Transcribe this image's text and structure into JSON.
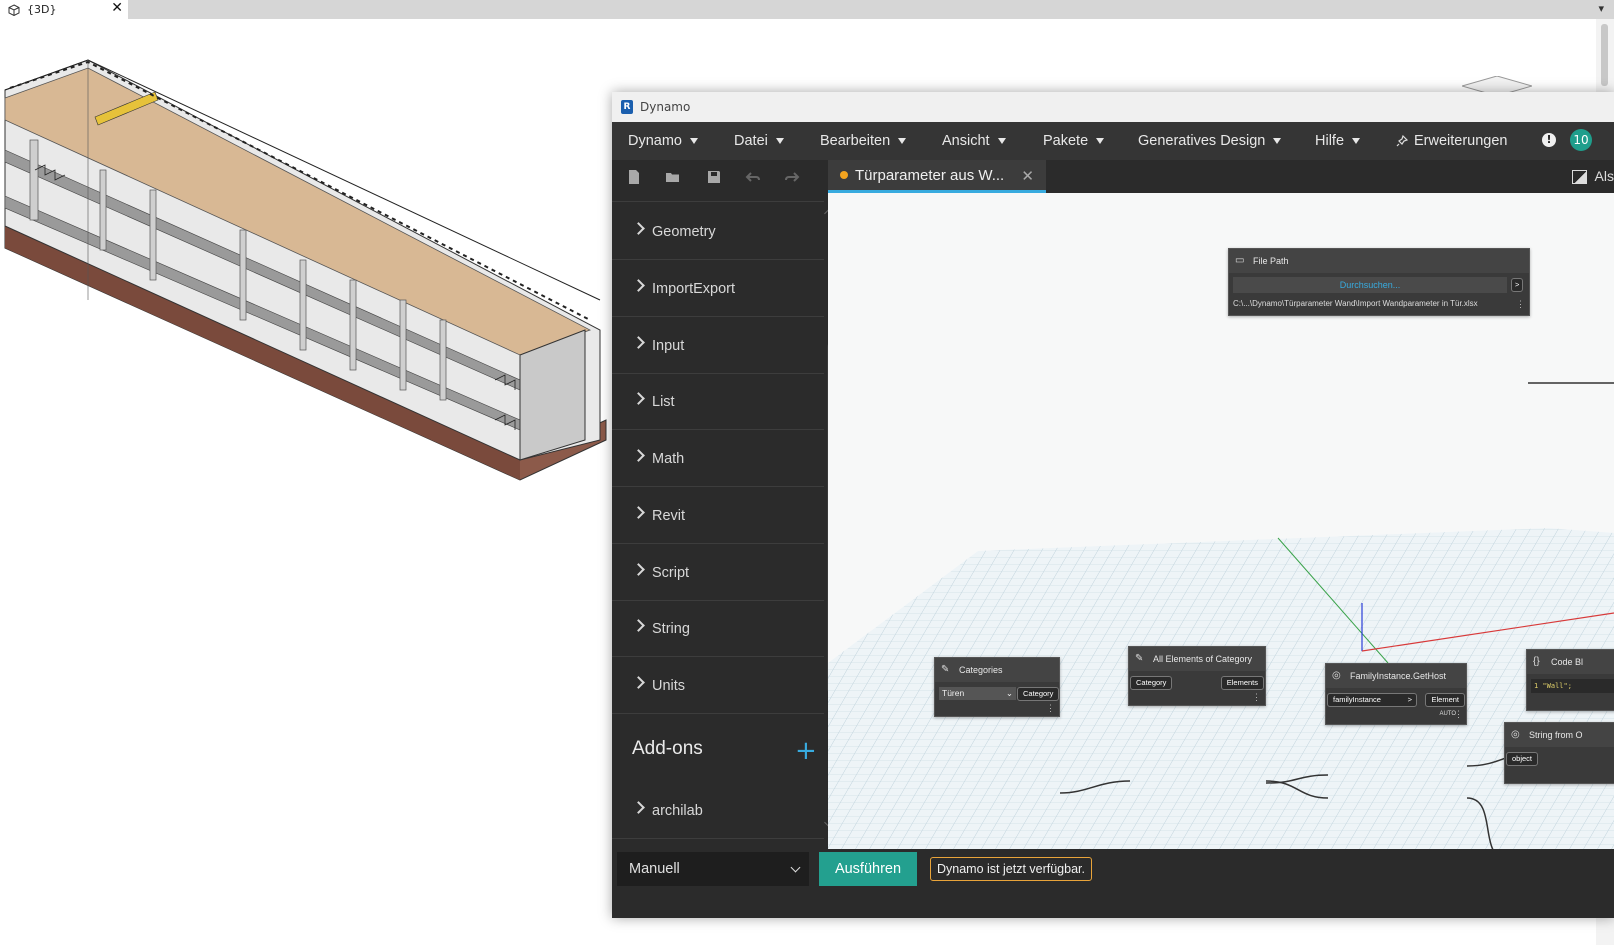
{
  "revit": {
    "tab_label": "{3D}",
    "tab_close": "✕",
    "tab_menu": "▾"
  },
  "dynamo": {
    "window_title": "Dynamo",
    "logo": "R",
    "menu": [
      {
        "label": "Dynamo"
      },
      {
        "label": "Datei"
      },
      {
        "label": "Bearbeiten"
      },
      {
        "label": "Ansicht"
      },
      {
        "label": "Pakete"
      },
      {
        "label": "Generatives Design"
      },
      {
        "label": "Hilfe"
      }
    ],
    "extensions_label": "Erweiterungen",
    "info_badge": "!",
    "notification_count": "10",
    "toolbar_icons": [
      "new-file-icon",
      "open-folder-icon",
      "save-icon",
      "undo-icon",
      "redo-icon"
    ],
    "file_tab": {
      "name": "Türparameter aus W...",
      "close": "✕"
    },
    "view_toggle_label": "Als",
    "library": {
      "items": [
        {
          "label": "Geometry"
        },
        {
          "label": "ImportExport"
        },
        {
          "label": "Input"
        },
        {
          "label": "List"
        },
        {
          "label": "Math"
        },
        {
          "label": "Revit"
        },
        {
          "label": "Script"
        },
        {
          "label": "String"
        },
        {
          "label": "Units"
        }
      ],
      "addons_title": "Add-ons",
      "addons_plus": "+",
      "addons_items": [
        {
          "label": "archilab"
        }
      ]
    },
    "nodes": {
      "file_path": {
        "title": "File Path",
        "browse": "Durchsuchen...",
        "path": "C:\\...\\Dynamo\\Türparameter Wand\\Import Wandparameter in Tür.xlsx",
        "out_port": ">"
      },
      "categories": {
        "title": "Categories",
        "value": "Türen",
        "out_port": "Category"
      },
      "all_elements": {
        "title": "All Elements of Category",
        "in_port": "Category",
        "out_port": "Elements"
      },
      "get_host": {
        "title": "FamilyInstance.GetHost",
        "in_port": "familyInstance",
        "in_arrow": ">",
        "out_port": "Element",
        "lacing": "AUTO"
      },
      "code_block": {
        "title": "Code Bl",
        "code": "1 \"Wall\";"
      },
      "string_from": {
        "title": "String from O",
        "in_port": "object"
      }
    },
    "run_mode": "Manuell",
    "run_button": "Ausführen",
    "status_message": "Dynamo ist jetzt verfügbar."
  }
}
